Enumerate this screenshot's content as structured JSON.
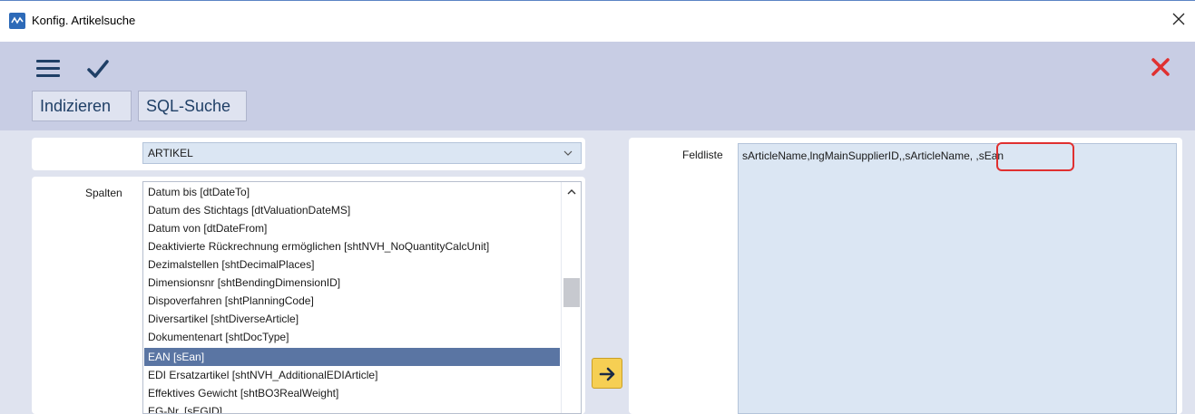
{
  "window": {
    "title": "Konfig. Artikelsuche",
    "icons": {
      "app": "app-wave-icon",
      "close": "close-icon"
    }
  },
  "toolbar": {
    "menu_icon": "hamburger-menu-icon",
    "confirm_icon": "checkmark-icon",
    "cancel_icon": "red-x-icon",
    "buttons": {
      "index_label": "Indizieren",
      "sql_label": "SQL-Suche"
    }
  },
  "table_select": {
    "value": "ARTIKEL"
  },
  "columns": {
    "label": "Spalten",
    "items": [
      "Datum bis [dtDateTo]",
      "Datum des Stichtags [dtValuationDateMS]",
      "Datum von [dtDateFrom]",
      "Deaktivierte Rückrechnung ermöglichen [shtNVH_NoQuantityCalcUnit]",
      "Dezimalstellen [shtDecimalPlaces]",
      "Dimensionsnr [shtBendingDimensionID]",
      "Dispoverfahren [shtPlanningCode]",
      "Diversartikel [shtDiverseArticle]",
      "Dokumentenart [shtDocType]",
      "EAN [sEan]",
      "EDI Ersatzartikel [shtNVH_AdditionalEDIArticle]",
      "Effektives Gewicht [shtBO3RealWeight]",
      "EG-Nr. [sEGID]"
    ],
    "selected_index": 9
  },
  "fieldlist": {
    "label": "Feldliste",
    "value": "sArticleName,lngMainSupplierID,,sArticleName, ,sEan"
  },
  "colors": {
    "toolbar_bg": "#c8cde4",
    "selection": "#5a75a3",
    "accent_red": "#e03030",
    "arrow_button": "#f6cf53",
    "icon_navy": "#1f3f66"
  }
}
